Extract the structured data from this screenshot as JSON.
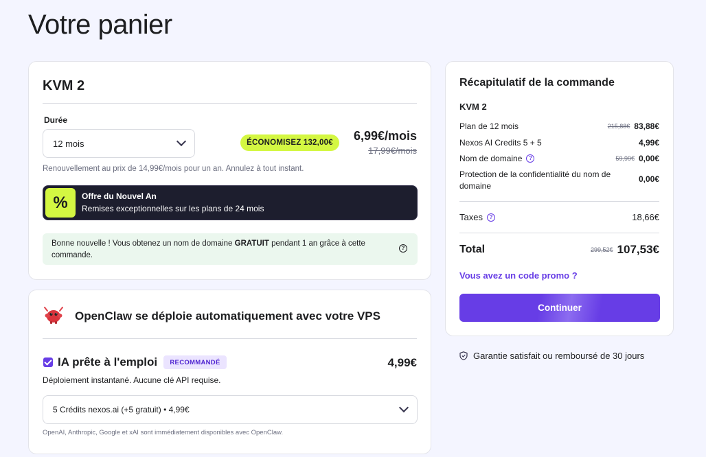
{
  "page": {
    "title": "Votre panier"
  },
  "plan": {
    "name": "KVM 2",
    "duration_label": "Durée",
    "duration_value": "12 mois",
    "savings_badge": "ÉCONOMISEZ 132,00€",
    "price": "6,99€/mois",
    "old_price": "17,99€/mois",
    "renewal_note": "Renouvellement au prix de 14,99€/mois pour un an. Annulez à tout instant.",
    "promo": {
      "symbol": "%",
      "title": "Offre du Nouvel An",
      "subtitle": "Remises exceptionnelles sur les plans de 24 mois"
    },
    "good_news": {
      "before": "Bonne nouvelle ! Vous obtenez un nom de domaine ",
      "bold": "GRATUIT",
      "after": " pendant 1 an grâce à cette commande.",
      "help_symbol": "?"
    }
  },
  "openclaw": {
    "title": "OpenClaw se déploie automatiquement avec votre VPS",
    "ai_title": "IA prête à l'emploi",
    "badge": "RECOMMANDÉ",
    "ai_price": "4,99€",
    "ai_checked": true,
    "description": "Déploiement instantané. Aucune clé API requise.",
    "credits_value": "5 Crédits nexos.ai (+5 gratuit) • 4,99€",
    "footnote": "OpenAI, Anthropic, Google et xAI sont immédiatement disponibles avec OpenClaw."
  },
  "summary": {
    "title": "Récapitulatif de la commande",
    "product": "KVM 2",
    "rows": [
      {
        "label": "Plan de 12 mois",
        "old": "215,88€",
        "amount": "83,88€"
      },
      {
        "label": "Nexos AI Credits 5 + 5",
        "old": "",
        "amount": "4,99€"
      },
      {
        "label": "Nom de domaine",
        "old": "59,99€",
        "amount": "0,00€",
        "help": "?"
      },
      {
        "label": "Protection de la confidentialité du nom de domaine",
        "old": "",
        "amount": "0,00€"
      }
    ],
    "tax": {
      "label": "Taxes",
      "amount": "18,66€",
      "help": "?"
    },
    "total": {
      "label": "Total",
      "old": "299,52€",
      "amount": "107,53€"
    },
    "promo_link": "Vous avez un code promo ?",
    "continue_label": "Continuer"
  },
  "guarantee": "Garantie satisfait ou remboursé de 30 jours",
  "colors": {
    "accent": "#673de6",
    "lime": "#d4f742",
    "dark": "#1d1e2e",
    "success_bg": "#ebf7ee",
    "page_bg": "#f4f5ff"
  },
  "icons": [
    "chevron-down-icon",
    "percent-icon",
    "help-icon",
    "openclaw-mascot-icon",
    "checkbox-checked-icon",
    "shield-check-icon"
  ]
}
